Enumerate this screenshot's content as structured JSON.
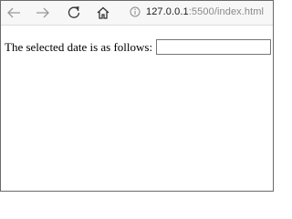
{
  "browser": {
    "url": {
      "host": "127.0.0.1",
      "port": ":5500",
      "path": "/index.html"
    },
    "icons": {
      "back": "back-arrow-icon",
      "forward": "forward-arrow-icon",
      "refresh": "refresh-icon",
      "home": "home-icon",
      "info": "info-icon"
    }
  },
  "page": {
    "label": "The selected date is as follows:",
    "date_input": {
      "value": "",
      "placeholder": ""
    }
  }
}
